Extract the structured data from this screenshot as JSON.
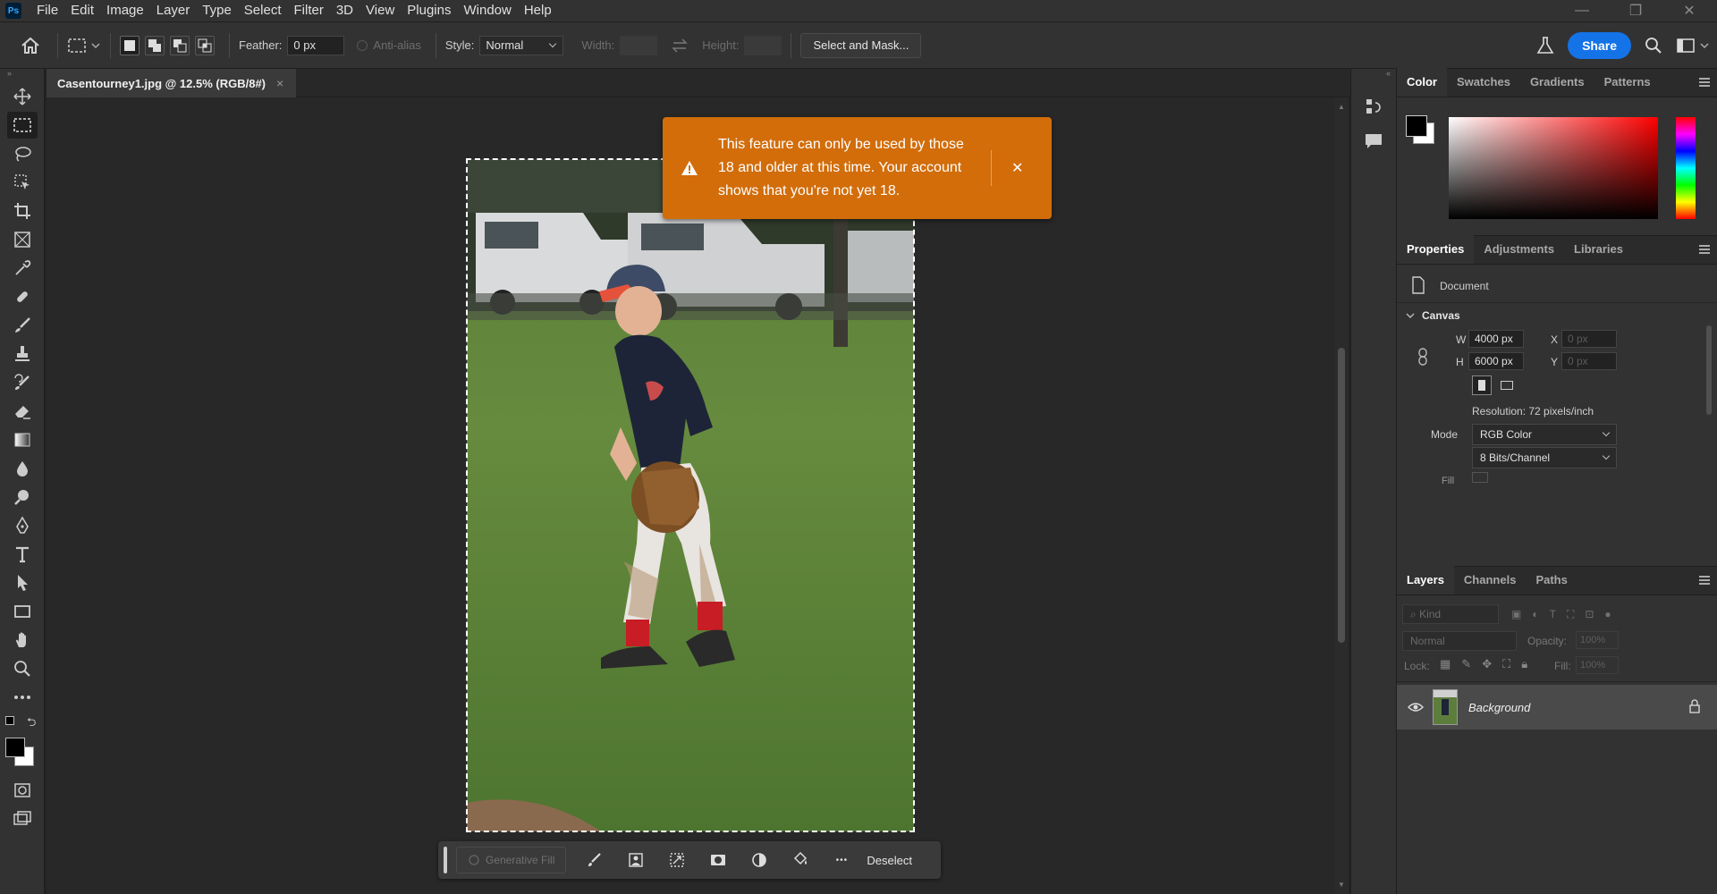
{
  "app": {
    "logo": "Ps"
  },
  "menu": [
    "File",
    "Edit",
    "Image",
    "Layer",
    "Type",
    "Select",
    "Filter",
    "3D",
    "View",
    "Plugins",
    "Window",
    "Help"
  ],
  "window_controls": {
    "minimize": "—",
    "restore": "❐",
    "close": "✕"
  },
  "options": {
    "feather_label": "Feather:",
    "feather_value": "0 px",
    "antialias_label": "Anti-alias",
    "style_label": "Style:",
    "style_value": "Normal",
    "width_label": "Width:",
    "height_label": "Height:",
    "select_mask_label": "Select and Mask...",
    "share_label": "Share"
  },
  "document": {
    "tab_title": "Casentourney1.jpg @ 12.5% (RGB/8#)",
    "close_glyph": "×"
  },
  "toast": {
    "message": "This feature can only be used by those 18 and older at this time. Your account shows that you're not yet 18.",
    "close_glyph": "✕"
  },
  "taskbar": {
    "generative_fill_label": "Generative Fill",
    "deselect_label": "Deselect",
    "more_glyph": "•••"
  },
  "color_panel": {
    "tabs": [
      "Color",
      "Swatches",
      "Gradients",
      "Patterns"
    ],
    "foreground": "#000000",
    "background": "#ffffff",
    "hue_color": "#ff0000"
  },
  "properties_panel": {
    "tabs": [
      "Properties",
      "Adjustments",
      "Libraries"
    ],
    "document_label": "Document",
    "canvas_label": "Canvas",
    "w_label": "W",
    "w_value": "4000 px",
    "h_label": "H",
    "h_value": "6000 px",
    "x_label": "X",
    "x_value": "0 px",
    "y_label": "Y",
    "y_value": "0 px",
    "resolution": "Resolution: 72 pixels/inch",
    "mode_label": "Mode",
    "mode_value": "RGB Color",
    "bits_value": "8 Bits/Channel",
    "fill_label": "Fill"
  },
  "layers_panel": {
    "tabs": [
      "Layers",
      "Channels",
      "Paths"
    ],
    "kind_label": "Kind",
    "blend_value": "Normal",
    "opacity_label": "Opacity:",
    "opacity_value": "100%",
    "lock_label": "Lock:",
    "fill_label": "Fill:",
    "fill_value": "100%",
    "layers": [
      {
        "name": "Background",
        "visible": true,
        "locked": true
      }
    ]
  },
  "colors": {
    "accent": "#1473e6",
    "toast": "#d26d0a",
    "panel": "#323232",
    "canvas_bg": "#282828"
  }
}
